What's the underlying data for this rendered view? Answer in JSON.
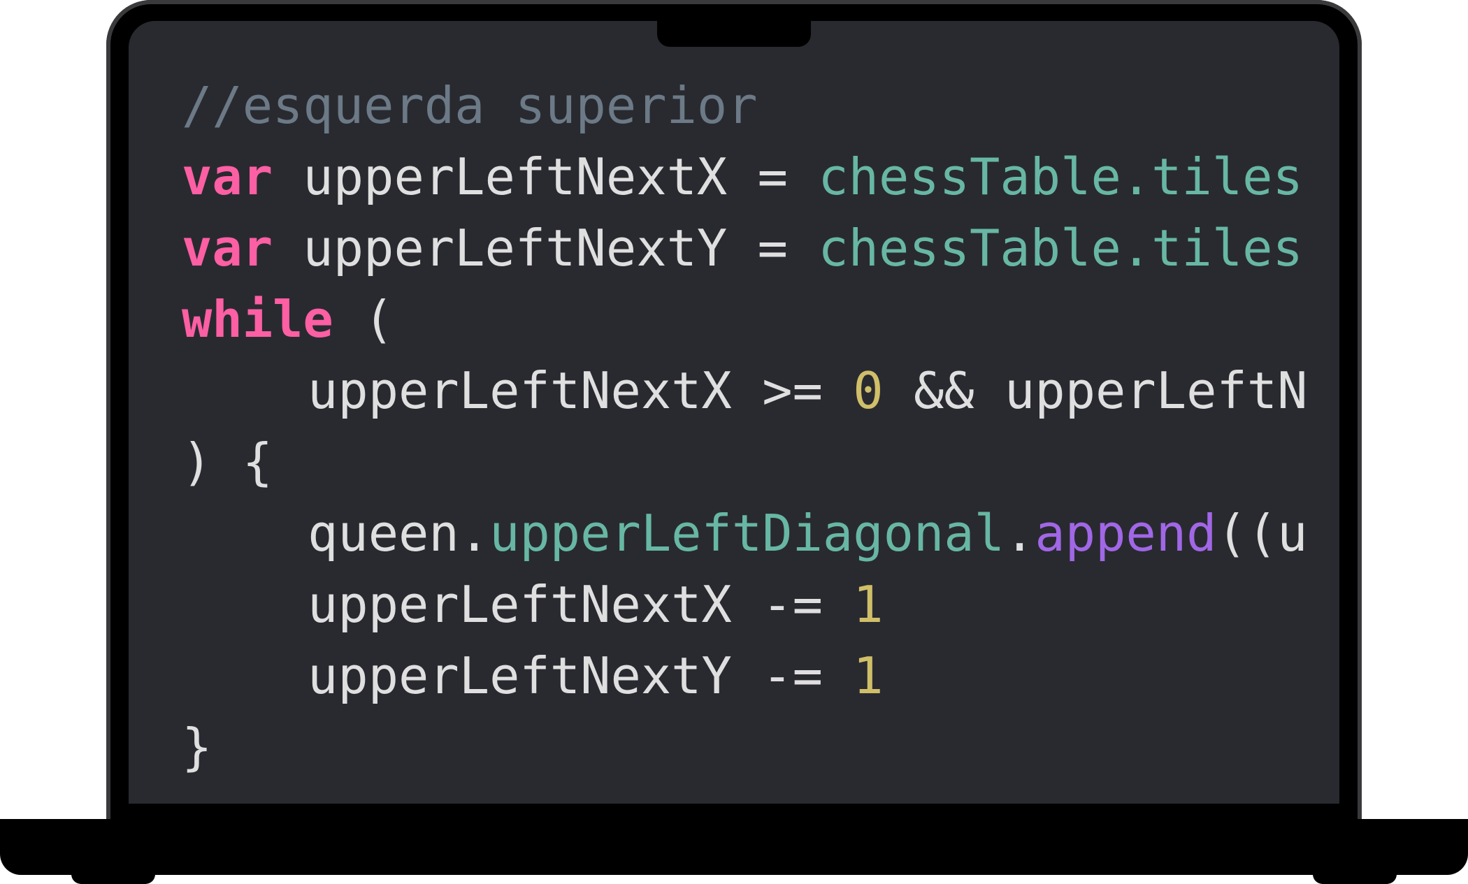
{
  "editor": {
    "colors": {
      "background": "#292a30",
      "comment": "#6c7986",
      "keyword": "#fc5fa3",
      "plain": "#dfdfe0",
      "type": "#67b7a4",
      "function": "#a167e6",
      "number": "#d0bf69"
    },
    "lines": [
      {
        "comment": "//esquerda superior"
      },
      {
        "kw": "var",
        "name": " upperLeftNextX = ",
        "expr": "chessTable.tiles"
      },
      {
        "kw": "var",
        "name": " upperLeftNextY = ",
        "expr": "chessTable.tiles"
      },
      {
        "kw": "while",
        "rest": " ("
      },
      {
        "a": "upperLeftNextX >= ",
        "num": "0",
        "b": " && upperLeftN"
      },
      {
        "text": ") {"
      },
      {
        "obj": "queen.",
        "prop": "upperLeftDiagonal",
        "dot": ".",
        "method": "append",
        "rest": "((u"
      },
      {
        "a": "upperLeftNextX -= ",
        "num": "1"
      },
      {
        "a": "upperLeftNextY -= ",
        "num": "1"
      },
      {
        "text": "}"
      }
    ]
  }
}
